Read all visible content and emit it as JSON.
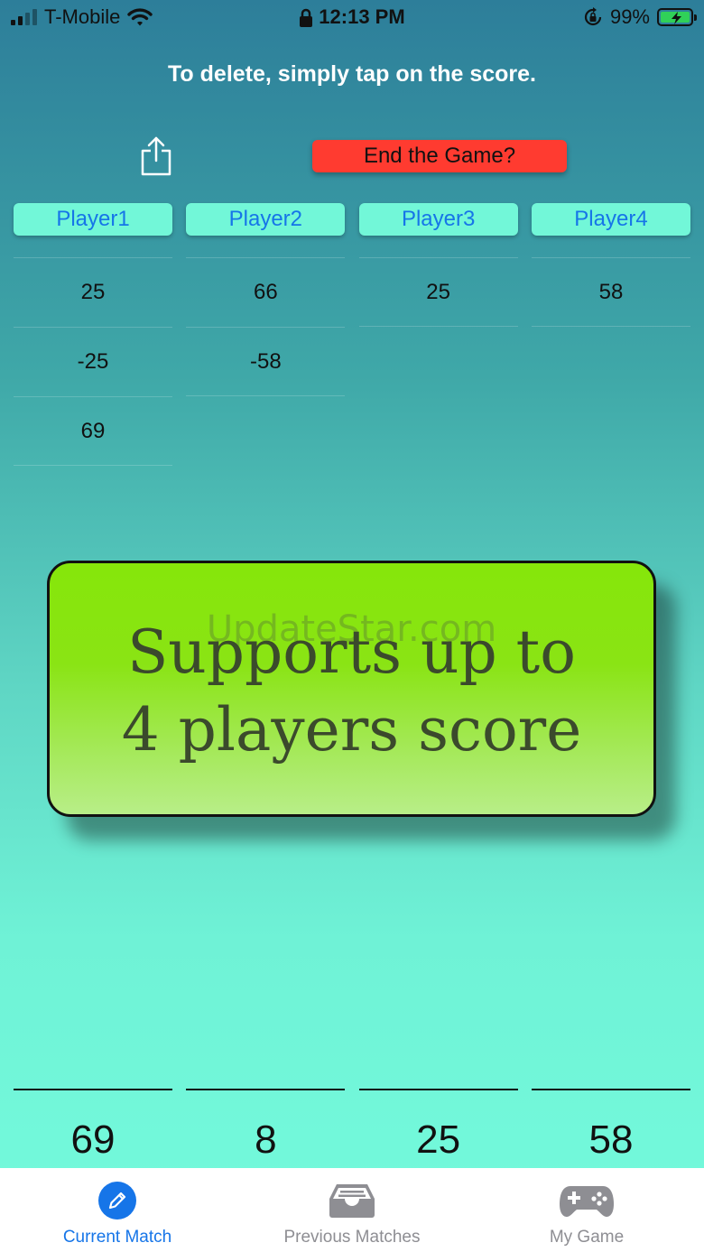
{
  "status_bar": {
    "carrier": "T-Mobile",
    "time": "12:13 PM",
    "battery": "99%"
  },
  "instruction": "To delete, simply tap on the score.",
  "actions": {
    "end_game_label": "End the Game?"
  },
  "players": [
    {
      "name": "Player1",
      "scores": [
        "25",
        "-25",
        "69"
      ],
      "total": "69"
    },
    {
      "name": "Player2",
      "scores": [
        "66",
        "-58"
      ],
      "total": "8"
    },
    {
      "name": "Player3",
      "scores": [
        "25"
      ],
      "total": "25"
    },
    {
      "name": "Player4",
      "scores": [
        "58"
      ],
      "total": "58"
    }
  ],
  "promo": {
    "line1": "Supports up to",
    "line2": "4 players score",
    "watermark": "UpdateStar.com"
  },
  "tabbar": {
    "items": [
      {
        "label": "Current Match",
        "icon": "pencil-icon",
        "active": true
      },
      {
        "label": "Previous Matches",
        "icon": "tray-icon",
        "active": false
      },
      {
        "label": "My Game",
        "icon": "gamepad-icon",
        "active": false
      }
    ]
  },
  "colors": {
    "accent": "#1675e8",
    "end_button": "#ff3b30",
    "player_button": "#72f7d8",
    "promo_green": "#86e60a"
  }
}
